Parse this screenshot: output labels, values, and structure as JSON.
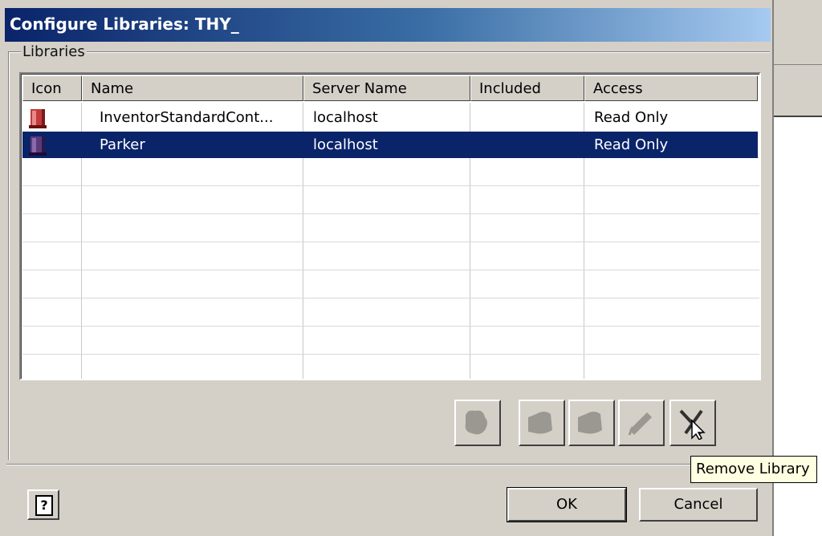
{
  "dialog": {
    "title": "Configure Libraries: THY_",
    "group_label": "Libraries"
  },
  "table": {
    "columns": [
      "Icon",
      "Name",
      "Server Name",
      "Included",
      "Access"
    ],
    "rows": [
      {
        "icon": "library-icon",
        "name": "InventorStandardCont...",
        "server": "localhost",
        "included": "",
        "access": "Read Only",
        "selected": false
      },
      {
        "icon": "library-icon",
        "name": "Parker",
        "server": "localhost",
        "included": "",
        "access": "Read Only",
        "selected": true
      }
    ]
  },
  "toolbar": {
    "buttons": [
      "add-library-icon",
      "edit-library-icon",
      "copy-library-icon",
      "rename-library-icon",
      "remove-library-icon"
    ]
  },
  "buttons": {
    "ok": "OK",
    "cancel": "Cancel",
    "help": "?"
  },
  "tooltip": "Remove Library",
  "colors": {
    "selection": "#0a246a",
    "title_start": "#0a246a",
    "title_end": "#a6caf0",
    "tooltip_bg": "#ffffe1",
    "library_icon": "#c23a3a"
  }
}
